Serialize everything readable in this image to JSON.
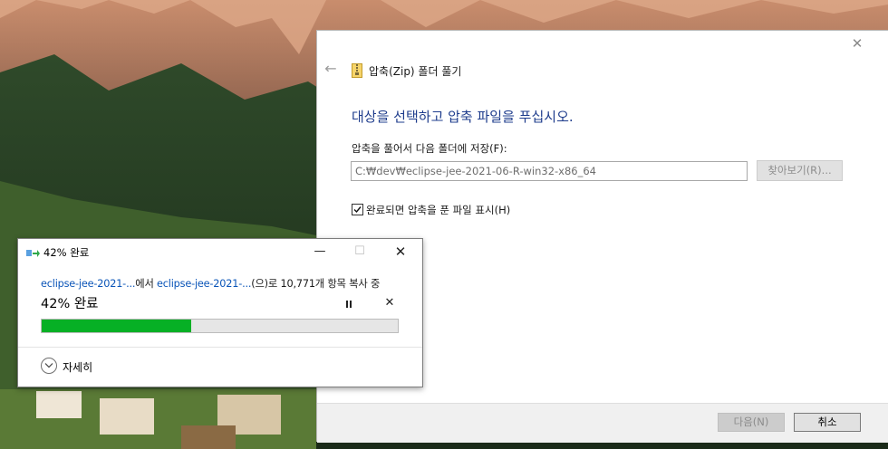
{
  "wizard": {
    "title": "압축(Zip) 폴더 풀기",
    "heading": "대상을 선택하고 압축 파일을 푸십시오.",
    "destination_label": "압축을 풀어서 다음 폴더에 저장(F):",
    "destination_value": "C:₩dev₩eclipse-jee-2021-06-R-win32-x86_64",
    "browse_label": "찾아보기(R)...",
    "show_files_label": "완료되면 압축을 푼 파일 표시(H)",
    "show_files_checked": true,
    "next_label": "다음(N)",
    "cancel_label": "취소"
  },
  "progress_dialog": {
    "title": "42% 완료",
    "source_link": "eclipse-jee-2021-...",
    "from_text": "에서 ",
    "dest_link": "eclipse-jee-2021-...",
    "copy_text": "(으)로 10,771개 항목 복사 중",
    "percent_label": "42% 완료",
    "progress": 0.42,
    "more_details_label": "자세히",
    "bar_color": "#06b025"
  },
  "icons": {
    "wizard_back": "back-arrow-icon",
    "wizard_close": "close-icon",
    "zip_folder": "zip-folder-icon",
    "copy_files": "copy-files-icon",
    "pause": "pause-icon",
    "stop": "stop-icon",
    "expand": "chevron-down-icon"
  }
}
